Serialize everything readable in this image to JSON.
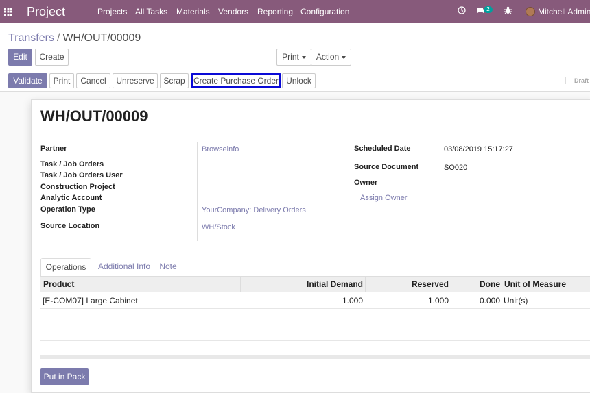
{
  "topbar": {
    "apps_icon": "grid-icon",
    "brand": "Project",
    "menu": [
      "Projects",
      "All Tasks",
      "Materials",
      "Vendors",
      "Reporting",
      "Configuration"
    ],
    "clock_icon": "clock-icon",
    "chat_icon": "chat-icon",
    "chat_badge": "2",
    "bug_icon": "bug-icon",
    "user": "Mitchell Admin"
  },
  "breadcrumb": {
    "parent": "Transfers",
    "separator": "/",
    "current": "WH/OUT/00009"
  },
  "controls": {
    "edit": "Edit",
    "create": "Create",
    "print": "Print",
    "action": "Action"
  },
  "statusbar": {
    "buttons": [
      "Validate",
      "Print",
      "Cancel",
      "Unreserve",
      "Scrap",
      "Create Purchase Order",
      "Unlock"
    ],
    "state": "Draft"
  },
  "form": {
    "title": "WH/OUT/00009",
    "left_labels": [
      "Partner",
      "Task / Job Orders",
      "Task / Job Orders User",
      "Construction Project",
      "Analytic Account",
      "Operation Type",
      "Source Location"
    ],
    "partner": "Browseinfo",
    "operation_type": "YourCompany: Delivery Orders",
    "source_location": "WH/Stock",
    "right_labels": [
      "Scheduled Date",
      "Source Document",
      "Owner"
    ],
    "scheduled_date": "03/08/2019 15:17:27",
    "source_document": "SO020",
    "owner_placeholder": "Assign Owner"
  },
  "tabs": [
    "Operations",
    "Additional Info",
    "Note"
  ],
  "table": {
    "headers": [
      "Product",
      "Initial Demand",
      "Reserved",
      "Done",
      "Unit of Measure"
    ],
    "rows": [
      [
        "[E-COM07] Large Cabinet",
        "1.000",
        "1.000",
        "0.000",
        "Unit(s)"
      ]
    ]
  },
  "footer": {
    "put_in_pack": "Put in Pack"
  }
}
